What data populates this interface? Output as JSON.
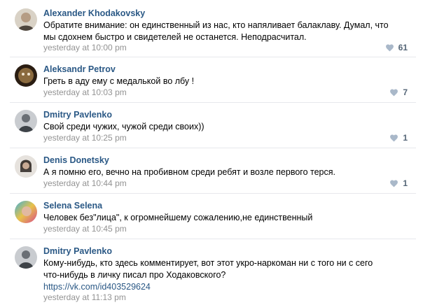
{
  "comments": [
    {
      "author": "Alexander Khodakovsky",
      "text": "Обратите внимание: он единственный из нас, кто напяливает балаклаву. Думал, что мы сдохнем быстро и свидетелей не останется. Неподрасчитал.",
      "link": "",
      "time": "yesterday at 10:00 pm",
      "likes": "61",
      "avatar_colors": [
        "#c7b9a5",
        "#5b4a3a"
      ]
    },
    {
      "author": "Aleksandr Petrov",
      "text": "Греть в аду ему с медалькой во лбу !",
      "link": "",
      "time": "yesterday at 10:03 pm",
      "likes": "7",
      "avatar_colors": [
        "#8a6a3e",
        "#2a1d12"
      ]
    },
    {
      "author": "Dmitry Pavlenko",
      "text": "Свой среди чужих, чужой среди своих))",
      "link": "",
      "time": "yesterday at 10:25 pm",
      "likes": "1",
      "avatar_colors": [
        "#9aa1a8",
        "#4a4f55"
      ]
    },
    {
      "author": "Denis Donetsky",
      "text": "А я помню его, вечно на пробивном среди ребят и возле первого терся.",
      "link": "",
      "time": "yesterday at 10:44 pm",
      "likes": "1",
      "avatar_colors": [
        "#b8b0a8",
        "#2b2622"
      ]
    },
    {
      "author": "Selena Selena",
      "text": "Человек без\"лица\", к огромнейшему сожалению,не единственный",
      "link": "",
      "time": "yesterday at 10:45 pm",
      "likes": "",
      "avatar_colors": [
        "#3fb0d8",
        "#d84a8a"
      ]
    },
    {
      "author": "Dmitry Pavlenko",
      "text": "Кому-нибудь, кто здесь комментирует, вот этот укро-наркоман ни с того ни с сего что-нибудь в личку писал про Ходаковского?",
      "link": "https://vk.com/id403529624",
      "time": "yesterday at 11:13 pm",
      "likes": "",
      "avatar_colors": [
        "#9aa1a8",
        "#4a4f55"
      ]
    }
  ],
  "heart_color": "#a9b8c9"
}
